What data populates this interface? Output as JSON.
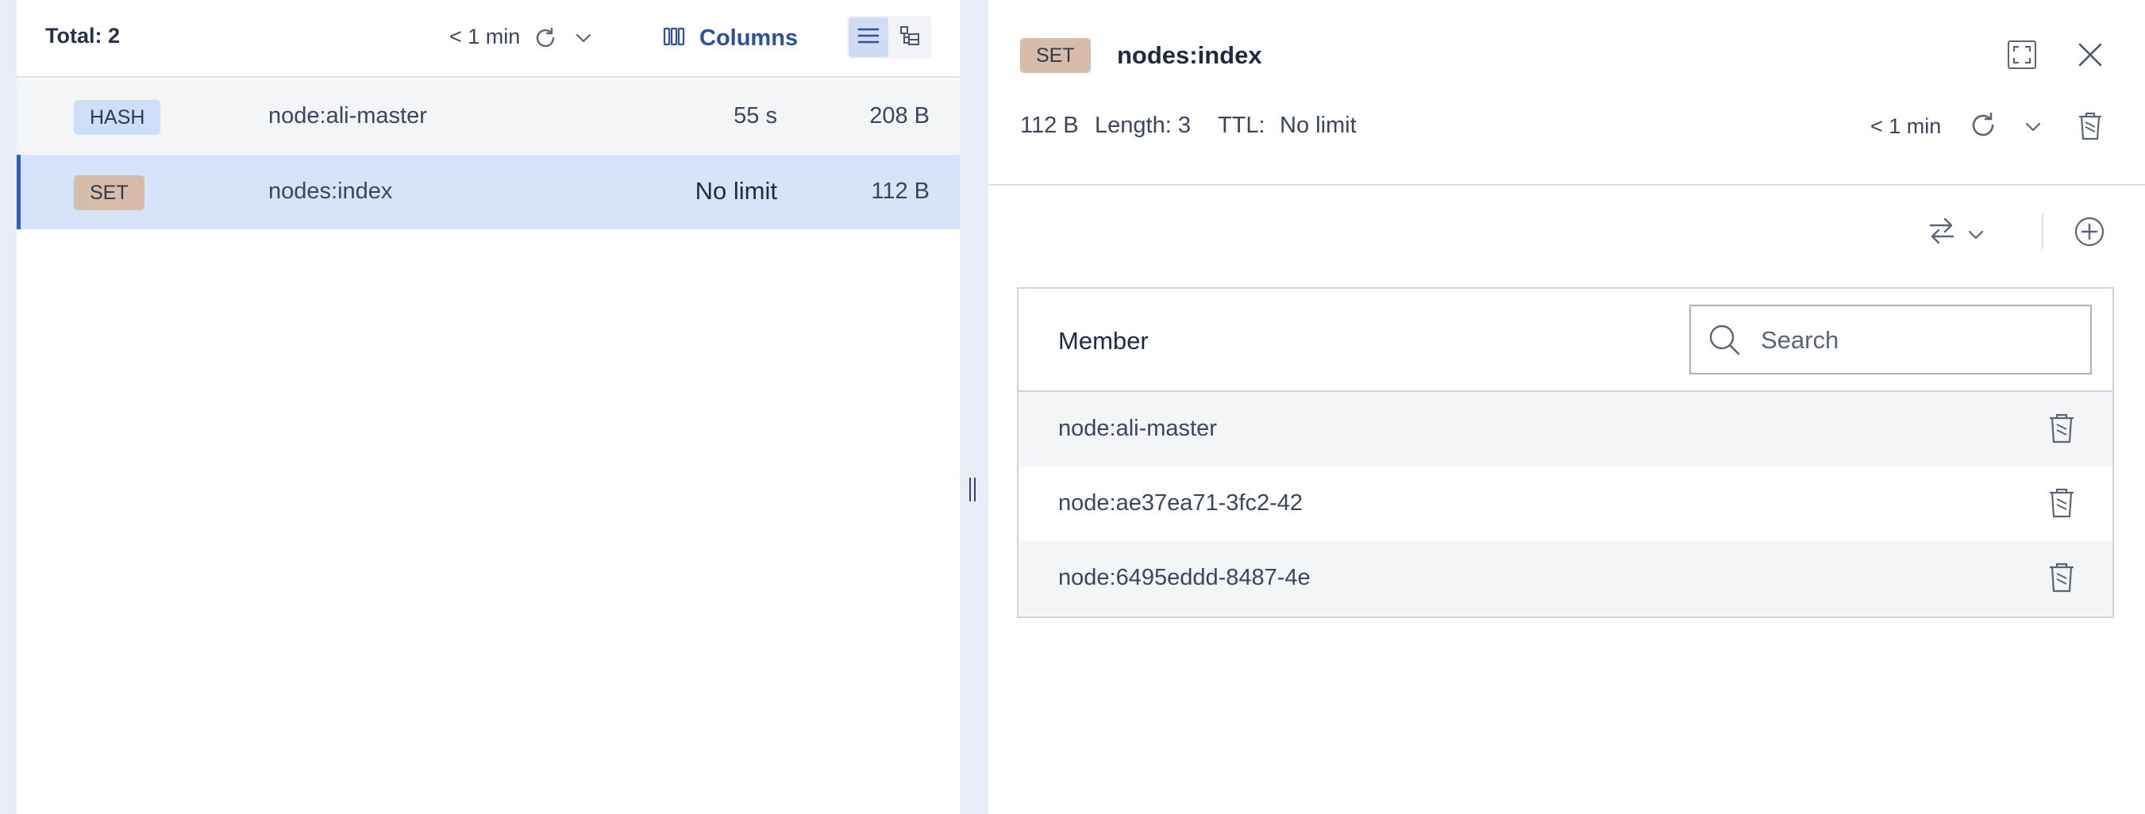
{
  "key_list": {
    "total_label": "Total: 2",
    "refresh_label": "< 1 min",
    "columns_label": "Columns",
    "rows": [
      {
        "type": "HASH",
        "name": "node:ali-master",
        "ttl": "55 s",
        "size": "208 B"
      },
      {
        "type": "SET",
        "name": "nodes:index",
        "ttl": "No limit",
        "size": "112 B"
      }
    ]
  },
  "details": {
    "type": "SET",
    "key_name": "nodes:index",
    "size": "112 B",
    "length": "Length: 3",
    "ttl_label": "TTL:",
    "ttl_value": "No limit",
    "refresh_label": "< 1 min",
    "member_column": "Member",
    "search_placeholder": "Search",
    "members": [
      "node:ali-master",
      "node:ae37ea71-3fc2-42",
      "node:6495eddd-8487-4e"
    ]
  },
  "icons": {
    "refresh": "refresh-icon",
    "columns": "columns-icon",
    "list_view": "list-view-icon",
    "tree_view": "tree-view-icon",
    "fullscreen": "fullscreen-icon",
    "close": "close-icon",
    "delete": "trash-icon",
    "format": "swap-arrows-icon",
    "add": "plus-circle-icon",
    "search": "search-icon"
  },
  "colors": {
    "accent": "#2b5fd0",
    "hash_badge": "#cddff6",
    "set_badge": "#d7bda9",
    "selected_row": "#d6e3f8"
  }
}
